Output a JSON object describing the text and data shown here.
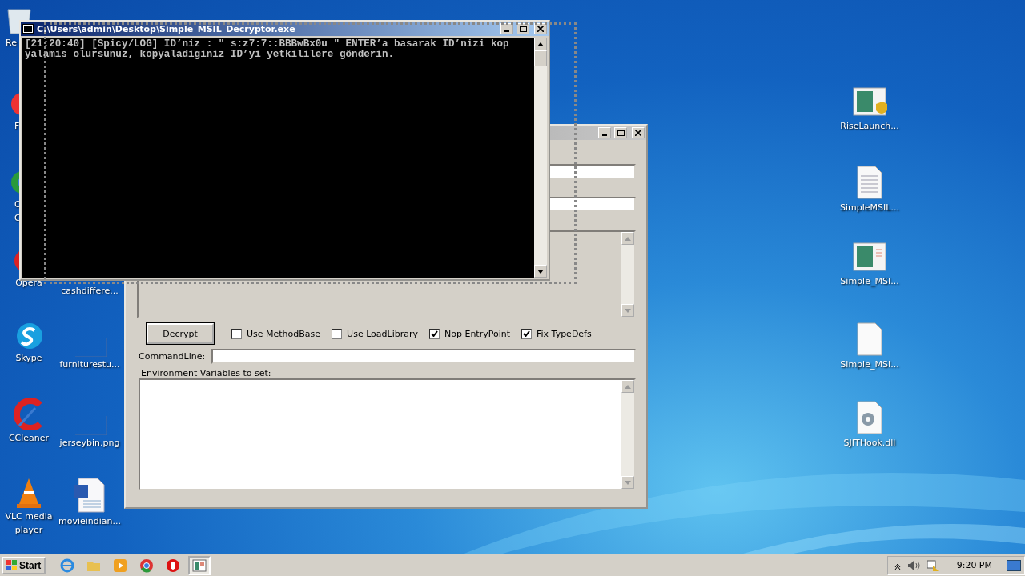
{
  "desktop_icons": [
    {
      "kind": "bin",
      "label": [
        "Re"
      ]
    },
    {
      "kind": "redapp",
      "label": [
        "F"
      ]
    },
    {
      "kind": "chrome",
      "label": [
        "C",
        "C"
      ]
    },
    {
      "kind": "opera",
      "label": [
        "Opera"
      ]
    },
    {
      "kind": "skype",
      "label": [
        "Skype"
      ]
    },
    {
      "kind": "ccleaner",
      "label": [
        "CCleaner"
      ]
    },
    {
      "kind": "vlc",
      "label": [
        "VLC media",
        "player"
      ]
    },
    {
      "label": [
        "cashdiffere..."
      ]
    },
    {
      "kind": "blank",
      "label": [
        "furniturestu..."
      ]
    },
    {
      "kind": "blank",
      "label": [
        "jerseybin.png"
      ]
    },
    {
      "kind": "word",
      "label": [
        "movieindian..."
      ]
    },
    {
      "kind": "exeshield",
      "label": [
        "RiseLaunch..."
      ]
    },
    {
      "kind": "text",
      "label": [
        "SimpleMSIL..."
      ]
    },
    {
      "kind": "exe",
      "label": [
        "Simple_MSI..."
      ]
    },
    {
      "kind": "file",
      "label": [
        "Simple_MSI..."
      ]
    },
    {
      "kind": "dll",
      "label": [
        "SJITHook.dll"
      ]
    }
  ],
  "decryptor_window": {
    "button": "Decrypt",
    "options": [
      {
        "label": "Use MethodBase",
        "checked": false
      },
      {
        "label": "Use LoadLibrary",
        "checked": false
      },
      {
        "label": "Nop EntryPoint",
        "checked": true
      },
      {
        "label": "Fix TypeDefs",
        "checked": true
      }
    ],
    "command_line_label": "CommandLine:",
    "env_label": "Environment Variables to set:"
  },
  "console_window": {
    "title": "C:\\Users\\admin\\Desktop\\Simple_MSIL_Decryptor.exe",
    "lines": [
      "[21:20:40] [Spicy/LOG] ID’niz : \" s:z7:7::BBBwBx0u \" ENTER’a basarak ID’nizi kop",
      "yalamis olursunuz, kopyaladiginiz ID’yi yetkililere gönderin."
    ]
  },
  "taskbar": {
    "start": "Start",
    "apps": [
      {
        "kind": "ie",
        "selected": false
      },
      {
        "kind": "folder",
        "selected": false
      },
      {
        "kind": "media",
        "selected": false
      },
      {
        "kind": "chrome",
        "selected": false
      },
      {
        "kind": "opera",
        "selected": false
      },
      {
        "kind": "window",
        "selected": true
      }
    ],
    "clock": "9:20 PM"
  }
}
